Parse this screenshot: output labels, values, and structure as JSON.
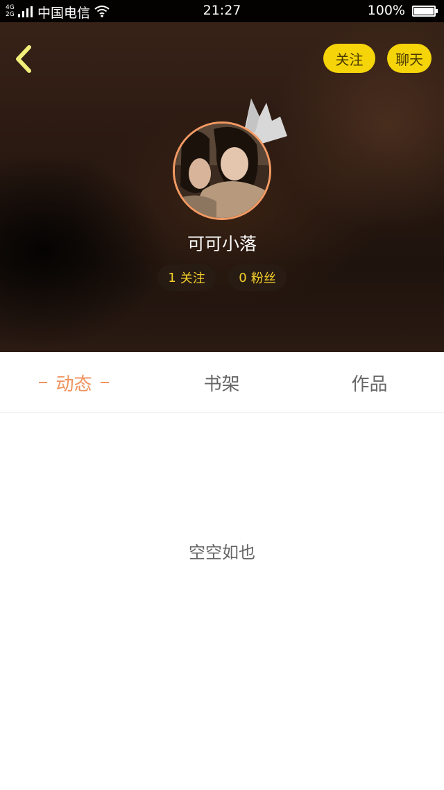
{
  "status_bar": {
    "network_tag_top": "4G",
    "network_tag_bottom": "2G",
    "carrier": "中国电信",
    "time": "21:27",
    "battery": "100%"
  },
  "header": {
    "follow_label": "关注",
    "chat_label": "聊天"
  },
  "profile": {
    "username": "可可小落",
    "following_count": "1",
    "following_label": "关注",
    "fans_count": "0",
    "fans_label": "粉丝"
  },
  "tabs": [
    {
      "label": "动态",
      "active": true
    },
    {
      "label": "书架",
      "active": false
    },
    {
      "label": "作品",
      "active": false
    }
  ],
  "content": {
    "empty_message": "空空如也"
  },
  "colors": {
    "accent": "#f0935e",
    "pill_yellow": "#f5d40a",
    "stat_text": "#f5cf2c"
  }
}
